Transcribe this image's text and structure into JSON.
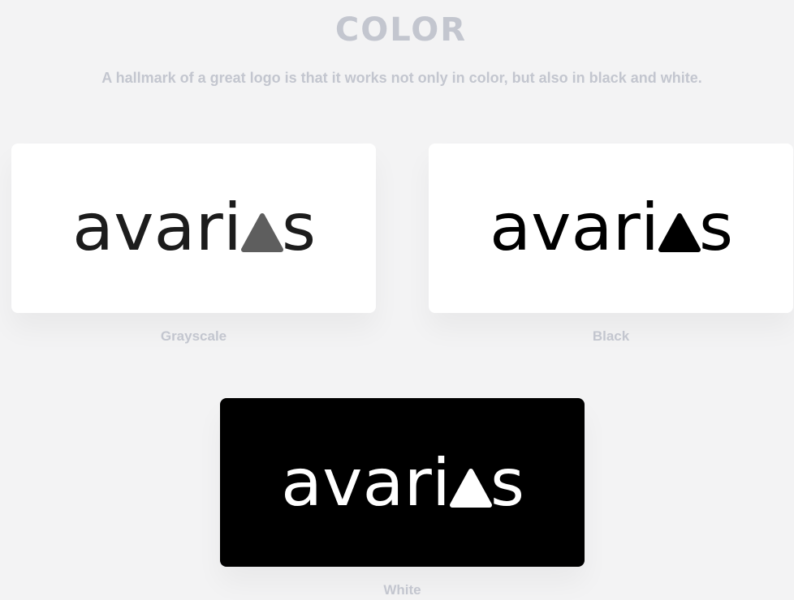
{
  "header": {
    "title": "COLOR",
    "subtitle": "A hallmark of a great logo is that it works not only in color, but also in black and white."
  },
  "logo": {
    "wordmark_prefix": "avari",
    "wordmark_suffix": "s",
    "glyph": "triangle-icon"
  },
  "variants": [
    {
      "label": "Grayscale",
      "text_color": "#1c1c1c",
      "triangle_color": "#5e5e5e",
      "background": "#ffffff"
    },
    {
      "label": "Black",
      "text_color": "#000000",
      "triangle_color": "#000000",
      "background": "#ffffff"
    },
    {
      "label": "White",
      "text_color": "#ffffff",
      "triangle_color": "#ffffff",
      "background": "#000000"
    }
  ]
}
